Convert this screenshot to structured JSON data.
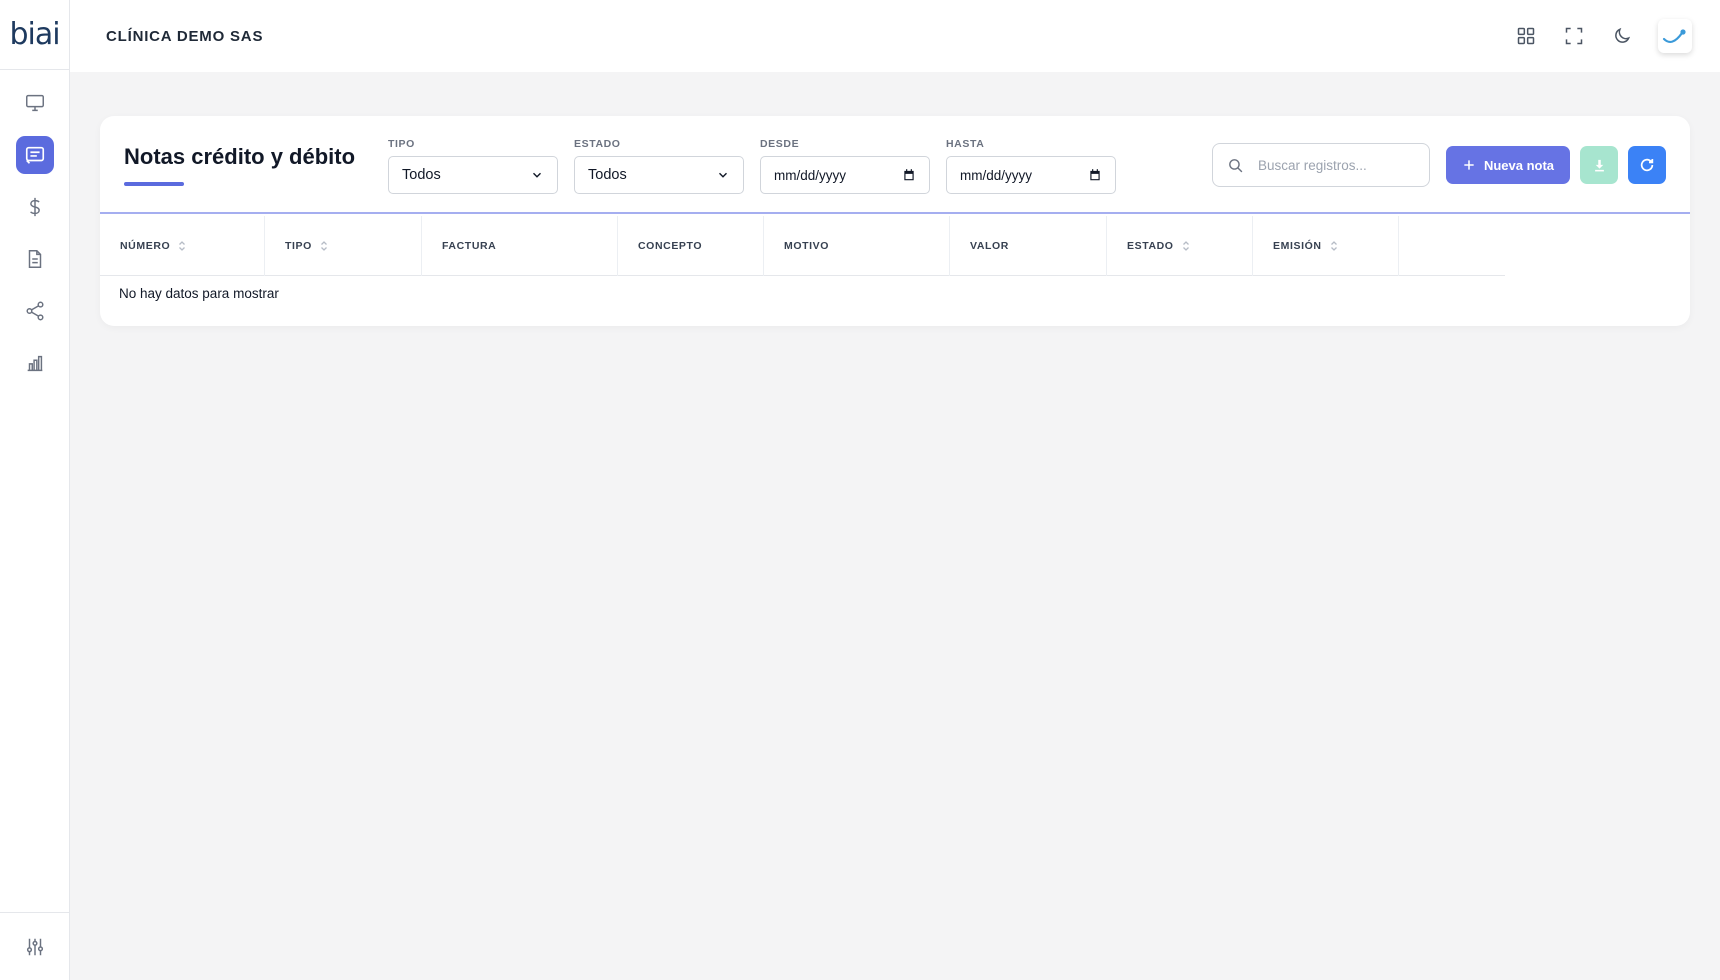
{
  "brand": {
    "logo_text": "biai",
    "accent": "#5b6bde"
  },
  "sidebar": {
    "items": [
      {
        "icon": "monitor-icon",
        "active": false
      },
      {
        "icon": "message-list-icon",
        "active": true
      },
      {
        "icon": "dollar-icon",
        "active": false
      },
      {
        "icon": "document-icon",
        "active": false
      },
      {
        "icon": "share-icon",
        "active": false
      },
      {
        "icon": "bar-chart-icon",
        "active": false
      }
    ],
    "bottom_icon": "sliders-icon"
  },
  "header": {
    "company": "CLÍNICA DEMO SAS",
    "actions": [
      "grid-icon",
      "fullscreen-icon",
      "moon-icon",
      "avatar"
    ]
  },
  "card": {
    "title": "Notas crédito y débito",
    "filters": {
      "tipo": {
        "label": "TIPO",
        "value": "Todos"
      },
      "estado": {
        "label": "ESTADO",
        "value": "Todos"
      },
      "desde": {
        "label": "DESDE",
        "value": "mm/dd/yyyy"
      },
      "hasta": {
        "label": "HASTA",
        "value": "mm/dd/yyyy"
      }
    },
    "search": {
      "placeholder": "Buscar registros..."
    },
    "buttons": {
      "new_label": "Nueva nota"
    }
  },
  "table": {
    "columns": [
      {
        "label": "NÚMERO",
        "sortable": true
      },
      {
        "label": "TIPO",
        "sortable": true
      },
      {
        "label": "FACTURA",
        "sortable": false
      },
      {
        "label": "CONCEPTO",
        "sortable": false
      },
      {
        "label": "MOTIVO",
        "sortable": false
      },
      {
        "label": "VALOR",
        "sortable": false
      },
      {
        "label": "ESTADO",
        "sortable": true
      },
      {
        "label": "EMISIÓN",
        "sortable": true
      }
    ],
    "empty_message": "No hay datos para mostrar"
  }
}
